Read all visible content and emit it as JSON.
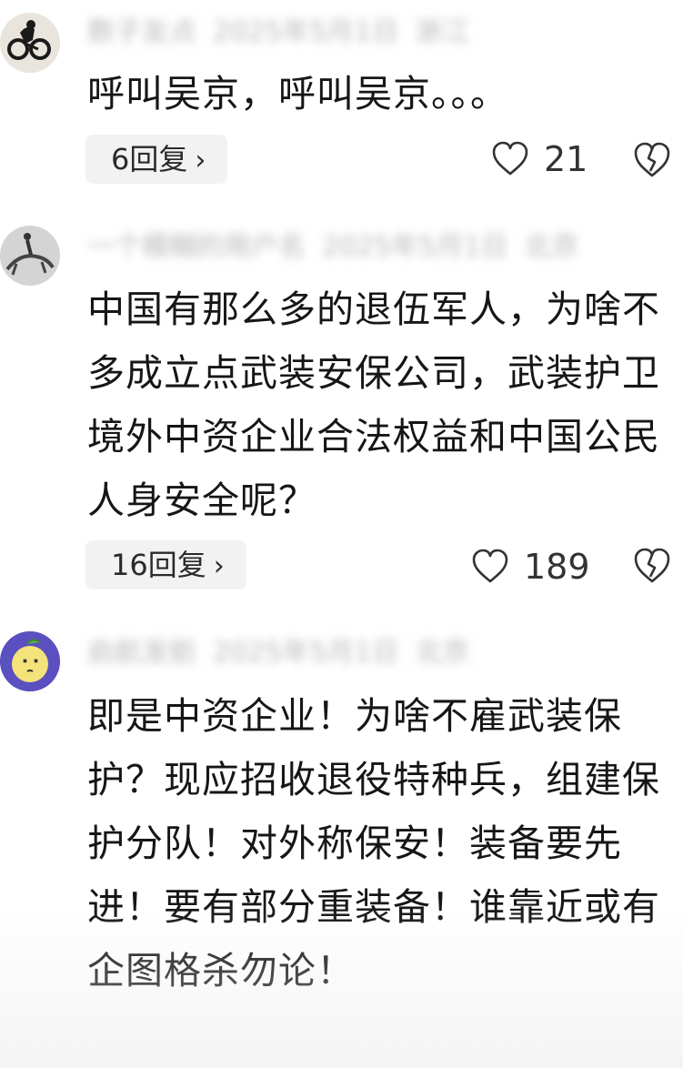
{
  "comments": [
    {
      "author": "数子友点",
      "date": "2025年5月1日",
      "location": "浙江",
      "text": "呼叫吴京，呼叫吴京。。。",
      "reply_label": "6回复",
      "likes": "21",
      "avatar_icon": "cyclist-silhouette-avatar",
      "like_icon": "heart-outline-icon",
      "dislike_icon": "broken-heart-icon"
    },
    {
      "author": "一个模糊的用户名",
      "date": "2025年5月1日",
      "location": "北京",
      "text": "中国有那么多的退伍军人，为啥不多成立点武装安保公司，武装护卫境外中资企业合法权益和中国公民人身安全呢？",
      "reply_label": "16回复",
      "likes": "189",
      "avatar_icon": "horse-rider-avatar",
      "like_icon": "heart-outline-icon",
      "dislike_icon": "broken-heart-icon"
    },
    {
      "author": "启航发航",
      "date": "2025年5月1日",
      "location": "北京",
      "text": "即是中资企业！为啥不雇武装保护？现应招收退役特种兵，组建保护分队！对外称保安！装备要先进！要有部分重装备！谁靠近或有企图格杀勿论！",
      "avatar_icon": "lemon-face-avatar"
    }
  ],
  "colors": {
    "text": "#161616",
    "meta_blur": "#b8b8b8",
    "pill_bg": "#f2f2f2",
    "icon_stroke": "#333333"
  }
}
